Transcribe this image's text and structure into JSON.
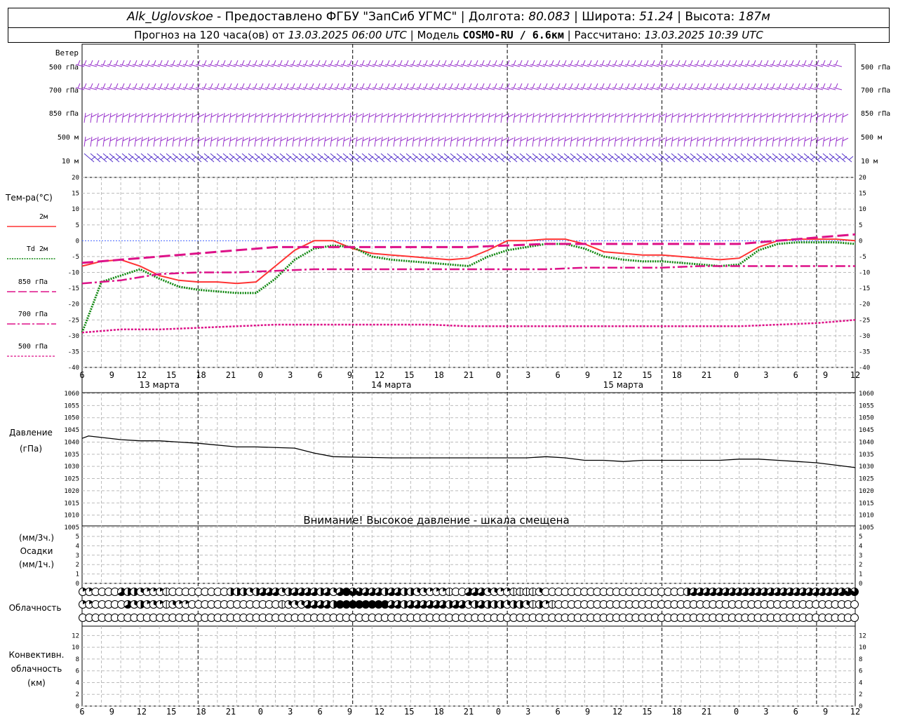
{
  "header": {
    "station": "Alk_Uglovskoe",
    "provider": "Предоставлено ФГБУ \"ЗапСиб УГМС\"",
    "lon_label": "Долгота:",
    "lon": "80.083",
    "lat_label": "Широта:",
    "lat": "51.24",
    "alt_label": "Высота:",
    "alt": "187м",
    "forecast": "Прогноз на 120 часа(ов) от",
    "start_time": "13.03.2025 06:00 UTC",
    "model_label": "Модель",
    "model": "COSMO-RU / 6.6км",
    "calc_label": "Рассчитано:",
    "calc_time": "13.03.2025 10:39 UTC"
  },
  "wind_panel": {
    "title": "Ветер",
    "levels": [
      "500 гПа",
      "700 гПа",
      "850 гПа",
      "500 м",
      "10 м"
    ]
  },
  "temp_panel": {
    "title": "Тем-ра(°C)",
    "legend": [
      {
        "label": "2м",
        "color": "#ff3333"
      },
      {
        "label": "Td 2м",
        "color": "#118811"
      },
      {
        "label": "850 гПа",
        "color": "#dd1188"
      },
      {
        "label": "700 гПа",
        "color": "#dd1188"
      },
      {
        "label": "500 гПа",
        "color": "#dd1188"
      }
    ],
    "ticks": [
      "20",
      "15",
      "10",
      "5",
      "0",
      "-5",
      "-10",
      "-15",
      "-20",
      "-25",
      "-30",
      "-35",
      "-40"
    ]
  },
  "time_axis": {
    "hour_labels": [
      "6",
      "9",
      "12",
      "15",
      "18",
      "21",
      "0",
      "3",
      "6",
      "9",
      "12",
      "15",
      "18",
      "21",
      "0",
      "3",
      "6",
      "9",
      "12",
      "15",
      "18",
      "21",
      "0",
      "3",
      "6",
      "9",
      "12"
    ],
    "day_labels": [
      "13 марта",
      "14 марта",
      "15 марта"
    ]
  },
  "pressure_panel": {
    "title": "Давление",
    "unit": "(гПа)",
    "ticks": [
      "1060",
      "1055",
      "1050",
      "1045",
      "1040",
      "1035",
      "1030",
      "1025",
      "1020",
      "1015",
      "1010",
      "1005"
    ],
    "warning": "Внимание! Высокое давление - шкала смещена"
  },
  "precip_panel": {
    "unit3": "(мм/3ч.)",
    "title": "Осадки",
    "unit1": "(мм/1ч.)",
    "ticks": [
      "5",
      "4",
      "3",
      "2",
      "1",
      "0"
    ]
  },
  "cloud_panel": {
    "title": "Облачность"
  },
  "conv_panel": {
    "title1": "Конвективн.",
    "title2": "облачность",
    "unit": "(км)",
    "ticks": [
      "12",
      "10",
      "8",
      "6",
      "4",
      "2",
      "0"
    ]
  },
  "chart_data": [
    {
      "type": "line",
      "title": "Тем-ра(°C)",
      "x_unit": "hours since 13.03.2025 06:00 UTC",
      "ylim": [
        -40,
        20
      ],
      "grid": true,
      "series": [
        {
          "name": "2м",
          "color": "#ff3333",
          "x": [
            0,
            3,
            6,
            9,
            12,
            15,
            18,
            21,
            24,
            27,
            30,
            33,
            36,
            39,
            42,
            45,
            48,
            51,
            54,
            57,
            60,
            63,
            66,
            69,
            72,
            75,
            78,
            81,
            84,
            87,
            90,
            93,
            96,
            99,
            102,
            105,
            108,
            111,
            114,
            117,
            120
          ],
          "y": [
            -8,
            -6.5,
            -6,
            -8,
            -11,
            -12.5,
            -13,
            -13,
            -13.5,
            -13,
            -8,
            -3,
            0,
            0,
            -2.5,
            -4,
            -4.5,
            -5,
            -5.5,
            -6,
            -5.5,
            -3,
            0,
            0,
            0.5,
            0.5,
            -1,
            -3.5,
            -4,
            -4.5,
            -4.5,
            -5,
            -5.5,
            -6,
            -5.5,
            -2,
            0,
            0.5,
            0.5,
            0.5,
            0
          ]
        },
        {
          "name": "Td 2м",
          "color": "#118811",
          "x": [
            0,
            3,
            6,
            9,
            12,
            15,
            18,
            21,
            24,
            27,
            30,
            33,
            36,
            39,
            42,
            45,
            48,
            51,
            54,
            57,
            60,
            63,
            66,
            69,
            72,
            75,
            78,
            81,
            84,
            87,
            90,
            93,
            96,
            99,
            102,
            105,
            108,
            111,
            114,
            117,
            120
          ],
          "y": [
            -29,
            -13,
            -11,
            -9,
            -12,
            -14.5,
            -15.5,
            -16,
            -16.5,
            -16.5,
            -12,
            -6,
            -2.5,
            -1.5,
            -2,
            -5,
            -6,
            -6.5,
            -7,
            -7.5,
            -8,
            -5,
            -3,
            -2,
            -1,
            -1,
            -2.5,
            -5,
            -6,
            -6.5,
            -6.5,
            -7,
            -7.5,
            -8,
            -7.5,
            -3,
            -1,
            -0.5,
            -0.5,
            -0.5,
            -1
          ]
        },
        {
          "name": "850 гПа",
          "color": "#dd1188",
          "x": [
            0,
            6,
            12,
            18,
            24,
            30,
            36,
            42,
            48,
            54,
            60,
            66,
            72,
            78,
            84,
            90,
            96,
            102,
            108,
            114,
            120
          ],
          "y": [
            -7,
            -6,
            -5,
            -4,
            -3,
            -2,
            -2,
            -2,
            -2,
            -2,
            -2,
            -1.5,
            -1,
            -1,
            -1,
            -1,
            -1,
            -1,
            0,
            1,
            2
          ]
        },
        {
          "name": "700 гПа",
          "color": "#dd1188",
          "x": [
            0,
            6,
            12,
            18,
            24,
            30,
            36,
            42,
            48,
            54,
            60,
            66,
            72,
            78,
            84,
            90,
            96,
            102,
            108,
            114,
            120
          ],
          "y": [
            -13.5,
            -12.5,
            -10.5,
            -10,
            -10,
            -9.5,
            -9,
            -9,
            -9,
            -9,
            -9,
            -9,
            -9,
            -8.5,
            -8.5,
            -8.5,
            -8,
            -8,
            -8,
            -8,
            -8
          ]
        },
        {
          "name": "500 гПа",
          "color": "#dd1188",
          "x": [
            0,
            6,
            12,
            18,
            24,
            30,
            36,
            42,
            48,
            54,
            60,
            66,
            72,
            78,
            84,
            90,
            96,
            102,
            108,
            114,
            120
          ],
          "y": [
            -29,
            -28,
            -28,
            -27.5,
            -27,
            -26.5,
            -26.5,
            -26.5,
            -26.5,
            -26.5,
            -27,
            -27,
            -27,
            -27,
            -27,
            -27,
            -27,
            -27,
            -26.5,
            -26,
            -25
          ]
        }
      ]
    },
    {
      "type": "line",
      "title": "Давление",
      "x_unit": "hours since 13.03.2025 06:00 UTC",
      "ylim": [
        1005,
        1060
      ],
      "grid": true,
      "series": [
        {
          "name": "Давление",
          "color": "#000000",
          "x": [
            0,
            1,
            6,
            9,
            12,
            18,
            24,
            27,
            33,
            36,
            39,
            48,
            51,
            57,
            63,
            66,
            69,
            72,
            75,
            78,
            81,
            84,
            87,
            90,
            93,
            96,
            99,
            102,
            105,
            108,
            111,
            114,
            117,
            120
          ],
          "y": [
            1041.5,
            1042.5,
            1041,
            1040.5,
            1040.5,
            1039.5,
            1038,
            1038,
            1037.5,
            1035.5,
            1034,
            1033.5,
            1033.5,
            1033.5,
            1033.5,
            1033.5,
            1033.5,
            1034,
            1033.5,
            1032.5,
            1032.5,
            1032,
            1032.5,
            1032.5,
            1032.5,
            1032.5,
            1032.5,
            1033,
            1033,
            1032.5,
            1032,
            1031.5,
            1030.5,
            1029.5
          ]
        }
      ]
    },
    {
      "type": "bar",
      "title": "Осадки",
      "x_unit": "hours since 13.03.2025 06:00 UTC",
      "ylim": [
        0,
        5
      ],
      "series": [
        {
          "name": "Осадки",
          "values": []
        }
      ]
    },
    {
      "type": "table",
      "title": "Облачность",
      "cover_rows_oktas": [
        [
          3,
          3,
          1,
          1,
          1,
          1,
          6,
          5,
          5,
          4,
          3,
          3,
          3,
          2,
          1,
          1,
          1,
          1,
          1,
          1,
          1,
          1,
          1,
          5,
          5,
          5,
          4,
          5,
          6,
          6,
          6,
          4,
          5,
          6,
          6,
          6,
          6,
          5,
          6,
          4,
          6,
          8,
          7,
          7,
          6,
          6,
          6,
          5,
          6,
          6,
          5,
          5,
          4,
          4,
          3,
          3,
          3,
          2,
          1,
          1,
          6,
          6,
          6,
          4,
          4,
          3,
          3,
          2,
          2,
          2,
          2,
          4,
          1,
          1,
          1,
          1,
          1,
          1,
          1,
          1,
          1,
          1,
          1,
          1,
          1,
          1,
          1,
          1,
          1,
          1,
          1,
          1,
          1,
          1,
          5,
          6,
          6,
          6,
          6,
          6,
          6,
          6,
          6,
          6,
          6,
          6,
          6,
          6,
          6,
          6,
          6,
          6,
          6,
          6,
          6,
          6,
          6,
          6,
          6,
          7,
          7,
          6
        ],
        [
          3,
          3,
          1,
          1,
          1,
          1,
          1,
          6,
          4,
          5,
          3,
          4,
          3,
          2,
          4,
          3,
          3,
          1,
          1,
          1,
          1,
          1,
          1,
          1,
          1,
          1,
          1,
          1,
          1,
          1,
          1,
          2,
          4,
          4,
          4,
          6,
          6,
          6,
          6,
          5,
          8,
          8,
          8,
          8,
          8,
          8,
          8,
          8,
          6,
          6,
          5,
          6,
          6,
          6,
          6,
          6,
          6,
          5,
          6,
          6,
          4,
          5,
          6,
          5,
          5,
          5,
          4,
          5,
          5,
          4,
          2,
          5,
          3,
          2,
          1,
          1,
          1,
          1,
          1,
          1,
          1,
          1,
          1,
          1,
          1,
          1,
          1,
          1,
          1,
          1,
          1,
          1,
          1,
          1,
          1,
          1,
          1,
          1,
          1,
          1,
          1,
          1,
          1,
          1,
          1,
          1,
          1,
          1,
          1,
          1,
          1,
          1,
          1,
          1,
          1,
          1,
          1,
          1,
          1,
          1,
          1,
          1,
          1,
          1,
          1,
          1,
          1,
          1,
          1,
          2,
          3
        ],
        [
          1,
          1,
          1,
          1,
          1,
          1,
          1,
          1,
          1,
          1,
          1,
          1,
          1,
          1,
          1,
          1,
          1,
          1,
          1,
          1,
          1,
          1,
          1,
          1,
          1,
          1,
          1,
          1,
          1,
          1,
          1,
          1,
          1,
          1,
          1,
          1,
          1,
          1,
          1,
          1,
          1,
          1,
          1,
          1,
          1,
          1,
          1,
          1,
          1,
          1,
          1,
          1,
          1,
          1,
          1,
          1,
          1,
          1,
          1,
          1,
          1,
          1,
          1,
          1,
          1,
          1,
          1,
          1,
          1,
          1,
          1,
          1,
          1,
          1,
          1,
          1,
          1,
          1,
          1,
          1,
          1,
          1,
          1,
          1,
          1,
          1,
          1,
          1,
          1,
          1,
          1,
          1,
          1,
          1,
          1,
          1,
          1,
          1,
          1,
          1,
          1,
          1,
          1,
          1,
          1,
          1,
          1,
          1,
          1,
          1,
          1,
          1,
          1,
          1,
          1,
          1,
          1,
          1,
          1,
          1,
          1,
          1,
          1,
          1
        ]
      ]
    },
    {
      "type": "bar",
      "title": "Конвективн. облачность",
      "x_unit": "hours since 13.03.2025 06:00 UTC",
      "ylim": [
        0,
        13
      ],
      "series": [
        {
          "name": "Конвективн. облачность",
          "values": []
        }
      ]
    }
  ]
}
